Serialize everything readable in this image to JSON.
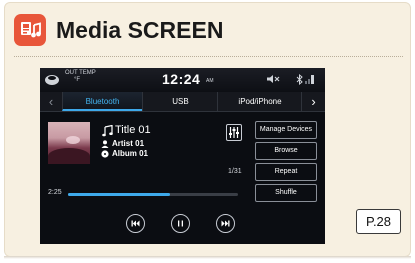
{
  "heading": "Media SCREEN",
  "page_ref": "P.28",
  "status_bar": {
    "out_temp_label": "OUT TEMP",
    "out_temp_value": "°F",
    "time": "12:24",
    "ampm": "AM"
  },
  "tabs": {
    "items": [
      "Bluetooth",
      "USB",
      "iPod/iPhone"
    ],
    "active": "Bluetooth"
  },
  "track": {
    "title": "Title 01",
    "artist": "Artist 01",
    "album": "Album 01",
    "count": "1/31",
    "elapsed": "2:25",
    "progress": 0.6
  },
  "menu": [
    "Manage Devices",
    "Browse",
    "Repeat",
    "Shuffle"
  ],
  "colors": {
    "accent": "#3ea9ea",
    "badge": "#e8563a",
    "card": "#f7f0e1"
  },
  "icons": {
    "badge": "media-screen-icon",
    "note": "music-note-icon",
    "artist": "artist-icon",
    "album": "album-icon",
    "eq": "equalizer-icon",
    "prev": "previous-track-icon",
    "pause": "pause-icon",
    "next": "next-track-icon"
  }
}
